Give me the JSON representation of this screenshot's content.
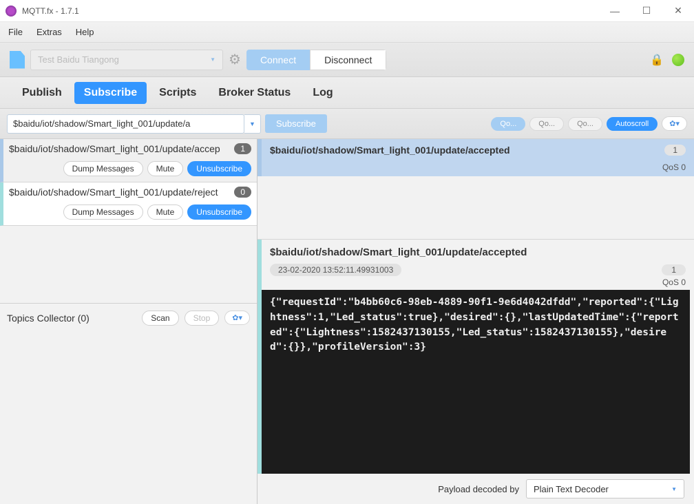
{
  "window": {
    "title": "MQTT.fx - 1.7.1"
  },
  "menu": {
    "file": "File",
    "extras": "Extras",
    "help": "Help"
  },
  "conn": {
    "profile": "Test Baidu Tiangong",
    "connect": "Connect",
    "disconnect": "Disconnect"
  },
  "tabs": {
    "publish": "Publish",
    "subscribe": "Subscribe",
    "scripts": "Scripts",
    "broker": "Broker Status",
    "log": "Log"
  },
  "subbar": {
    "topic_input": "$baidu/iot/shadow/Smart_light_001/update/a",
    "subscribe_btn": "Subscribe",
    "qo1": "Qo...",
    "qo2": "Qo...",
    "qo3": "Qo...",
    "autoscroll": "Autoscroll"
  },
  "subs": [
    {
      "topic": "$baidu/iot/shadow/Smart_light_001/update/accep",
      "count": "1",
      "dump": "Dump Messages",
      "mute": "Mute",
      "unsub": "Unsubscribe"
    },
    {
      "topic": "$baidu/iot/shadow/Smart_light_001/update/reject",
      "count": "0",
      "dump": "Dump Messages",
      "mute": "Mute",
      "unsub": "Unsubscribe"
    }
  ],
  "collector": {
    "label": "Topics Collector (0)",
    "scan": "Scan",
    "stop": "Stop"
  },
  "msg": {
    "topic": "$baidu/iot/shadow/Smart_light_001/update/accepted",
    "count": "1",
    "qos": "QoS 0"
  },
  "detail": {
    "topic": "$baidu/iot/shadow/Smart_light_001/update/accepted",
    "timestamp": "23-02-2020  13:52:11.49931003",
    "seq": "1",
    "qos": "QoS 0",
    "payload": "{\"requestId\":\"b4bb60c6-98eb-4889-90f1-9e6d4042dfdd\",\"reported\":{\"Lightness\":1,\"Led_status\":true},\"desired\":{},\"lastUpdatedTime\":{\"reported\":{\"Lightness\":1582437130155,\"Led_status\":1582437130155},\"desired\":{}},\"profileVersion\":3}"
  },
  "decoder": {
    "label": "Payload decoded by",
    "value": "Plain Text Decoder"
  }
}
